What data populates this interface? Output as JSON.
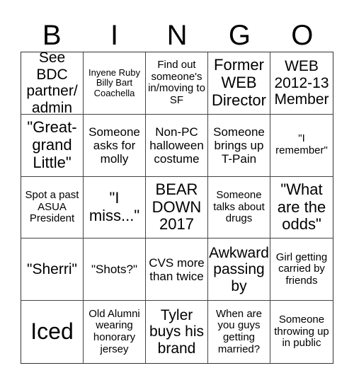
{
  "header": {
    "letters": [
      "B",
      "I",
      "N",
      "G",
      "O"
    ]
  },
  "cells": [
    "See BDC partner/ admin",
    "Inyene Ruby Billy Bart Coachella",
    "Find out someone's in/moving to SF",
    "Former WEB Director",
    "WEB 2012-13 Member",
    "\"Great-grand Little\"",
    "Someone asks for molly",
    "Non-PC halloween costume",
    "Someone brings up T-Pain",
    "\"I remember\"",
    "Spot a past ASUA President",
    "\"I miss...\"",
    "BEAR DOWN 2017",
    "Someone talks about drugs",
    "\"What are the odds\"",
    "\"Sherri\"",
    "\"Shots?\"",
    "CVS more than twice",
    "Awkward passing by",
    "Girl getting carried by friends",
    "Iced",
    "Old Alumni wearing honorary jersey",
    "Tyler buys his brand",
    "When are you guys getting married?",
    "Someone throwing up in public"
  ]
}
